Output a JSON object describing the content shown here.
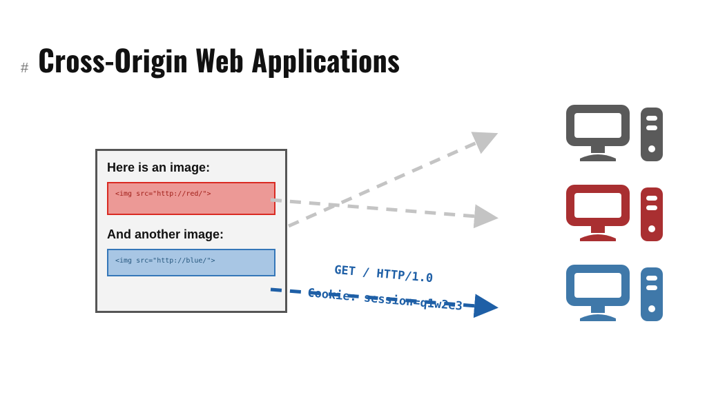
{
  "hash": "#",
  "title": "Cross-Origin Web Applications",
  "panel": {
    "heading1": "Here is an image:",
    "code1": "<img src=\"http://red/\">",
    "heading2": "And another image:",
    "code2": "<img src=\"http://blue/\">"
  },
  "request": {
    "line1": "GET / HTTP/1.0",
    "line2": "Cookie: session=q1w2e3"
  },
  "colors": {
    "grey": "#5a5a5a",
    "red": "#a92f31",
    "blue": "#3f78a9",
    "arrow_grey": "#c4c4c4",
    "arrow_blue": "#1e5fa6"
  }
}
